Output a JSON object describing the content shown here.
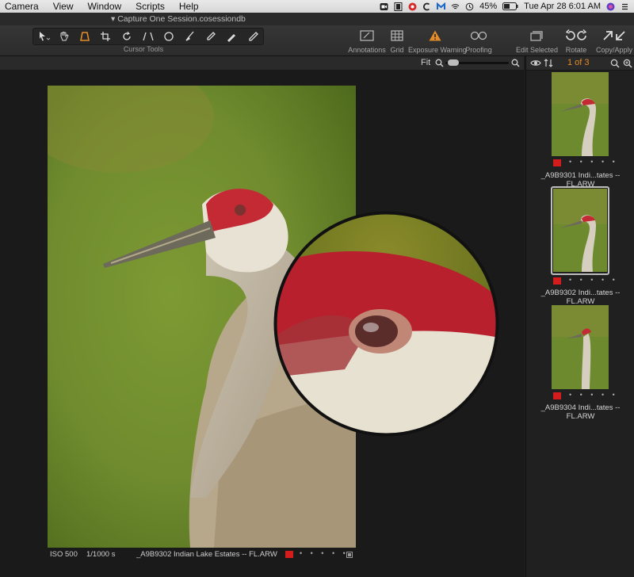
{
  "menubar": {
    "items": [
      "Camera",
      "View",
      "Window",
      "Scripts",
      "Help"
    ],
    "battery": "45%",
    "datetime": "Tue Apr 28  6:01 AM"
  },
  "window": {
    "title": "Capture One Session.cosessiondb"
  },
  "toolbar": {
    "cursor_tools_label": "Cursor Tools",
    "buttons": {
      "annotations": "Annotations",
      "grid": "Grid",
      "exposure_warning": "Exposure Warning",
      "proofing": "Proofing",
      "edit_selected": "Edit Selected",
      "rotate": "Rotate",
      "copy_apply": "Copy/Apply"
    },
    "accent_color": "#e38b28"
  },
  "viewer": {
    "zoom": "Fit",
    "status": {
      "iso": "ISO 500",
      "shutter": "1/1000 s",
      "filename": "_A9B9302 Indian Lake Estates -- FL.ARW",
      "dots": "• • • • •"
    }
  },
  "browser": {
    "count": "1 of 3",
    "thumbnails": [
      {
        "name": "_A9B9301 Indi...tates -- FL.ARW",
        "dots": "• • • • •"
      },
      {
        "name": "_A9B9302 Indi...tates -- FL.ARW",
        "dots": "• • • • •"
      },
      {
        "name": "_A9B9304 Indi...tates -- FL.ARW",
        "dots": "• • • • •"
      }
    ],
    "color_tag": "#d31c1c"
  }
}
